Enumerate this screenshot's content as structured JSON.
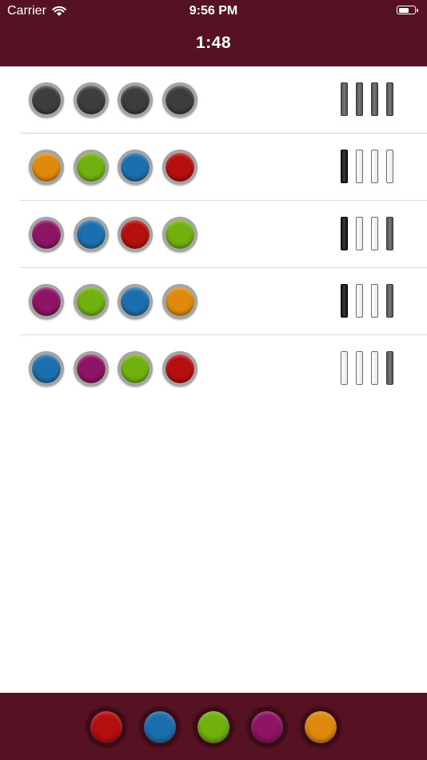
{
  "status_bar": {
    "carrier": "Carrier",
    "time": "9:56 PM"
  },
  "header": {
    "timer": "1:48"
  },
  "colors": {
    "header_bg": "#561223",
    "empty": "#3d3d3d",
    "orange": "#df8a0e",
    "green": "#71b10f",
    "blue": "#1c6fae",
    "red": "#b50f0f",
    "purple": "#8e1465"
  },
  "rows": [
    {
      "pegs": [
        "empty",
        "empty",
        "empty",
        "empty"
      ],
      "feedback": [
        "gray",
        "gray",
        "gray",
        "gray"
      ]
    },
    {
      "pegs": [
        "orange",
        "green",
        "blue",
        "red"
      ],
      "feedback": [
        "black",
        "white",
        "white",
        "white"
      ]
    },
    {
      "pegs": [
        "purple",
        "blue",
        "red",
        "green"
      ],
      "feedback": [
        "black",
        "white",
        "white",
        "gray"
      ]
    },
    {
      "pegs": [
        "purple",
        "green",
        "blue",
        "orange"
      ],
      "feedback": [
        "black",
        "white",
        "white",
        "gray"
      ]
    },
    {
      "pegs": [
        "blue",
        "purple",
        "green",
        "red"
      ],
      "feedback": [
        "white",
        "white",
        "white",
        "gray"
      ]
    }
  ],
  "palette": [
    "red",
    "blue",
    "green",
    "purple",
    "orange"
  ]
}
